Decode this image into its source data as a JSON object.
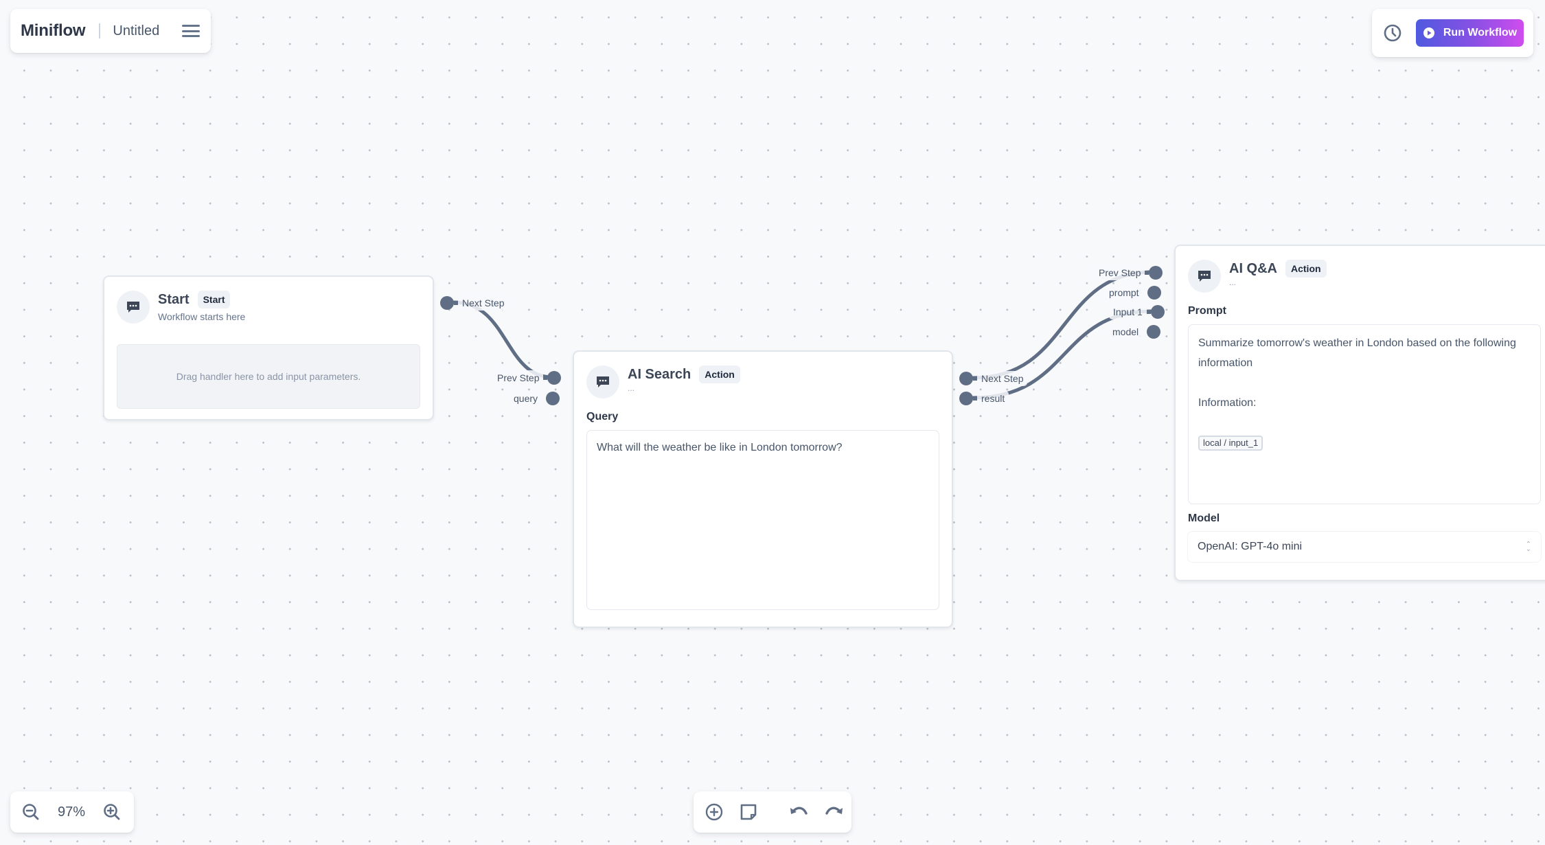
{
  "header": {
    "app_name": "Miniflow",
    "document_title": "Untitled",
    "menu_icon": "hamburger-menu-icon"
  },
  "toolbar_right": {
    "history_icon": "clock-icon",
    "run_label": "Run Workflow",
    "run_icon": "play-circle-icon",
    "accent_gradient": [
      "#4f5ae0",
      "#cf4dee"
    ]
  },
  "nodes": {
    "start": {
      "title": "Start",
      "badge": "Start",
      "subtitle": "Workflow starts here",
      "icon": "chat-bubble-icon",
      "drop_hint": "Drag handler here to add input parameters.",
      "outputs": [
        {
          "label": "Next Step"
        }
      ]
    },
    "ai_search": {
      "title": "AI Search",
      "badge": "Action",
      "subtitle": "...",
      "icon": "chat-bubble-icon",
      "inputs": [
        {
          "label": "Prev Step"
        },
        {
          "label": "query"
        }
      ],
      "outputs": [
        {
          "label": "Next Step"
        },
        {
          "label": "result"
        }
      ],
      "query_label": "Query",
      "query_value": "What will the weather be like in London tomorrow?"
    },
    "ai_qa": {
      "title": "AI Q&A",
      "badge": "Action",
      "subtitle": "...",
      "icon": "chat-bubble-icon",
      "inputs": [
        {
          "label": "Prev Step"
        },
        {
          "label": "prompt"
        },
        {
          "label": "Input 1"
        },
        {
          "label": "model"
        }
      ],
      "prompt_label": "Prompt",
      "prompt_line1": "Summarize tomorrow's weather in London based on the following information",
      "prompt_line2": "Information:",
      "prompt_variable": "local / input_1",
      "model_label": "Model",
      "model_value": "OpenAI: GPT-4o mini"
    }
  },
  "edges": [
    {
      "from": "start.Next Step",
      "to": "ai_search.Prev Step"
    },
    {
      "from": "ai_search.Next Step",
      "to": "ai_qa.Prev Step"
    },
    {
      "from": "ai_search.result",
      "to": "ai_qa.Input 1"
    }
  ],
  "zoom": {
    "level": "97%",
    "zoom_out_icon": "zoom-out-icon",
    "zoom_in_icon": "zoom-in-icon"
  },
  "bottom_toolbar": {
    "icons": [
      "add-node-icon",
      "sticky-note-icon",
      "undo-icon",
      "redo-icon"
    ]
  }
}
